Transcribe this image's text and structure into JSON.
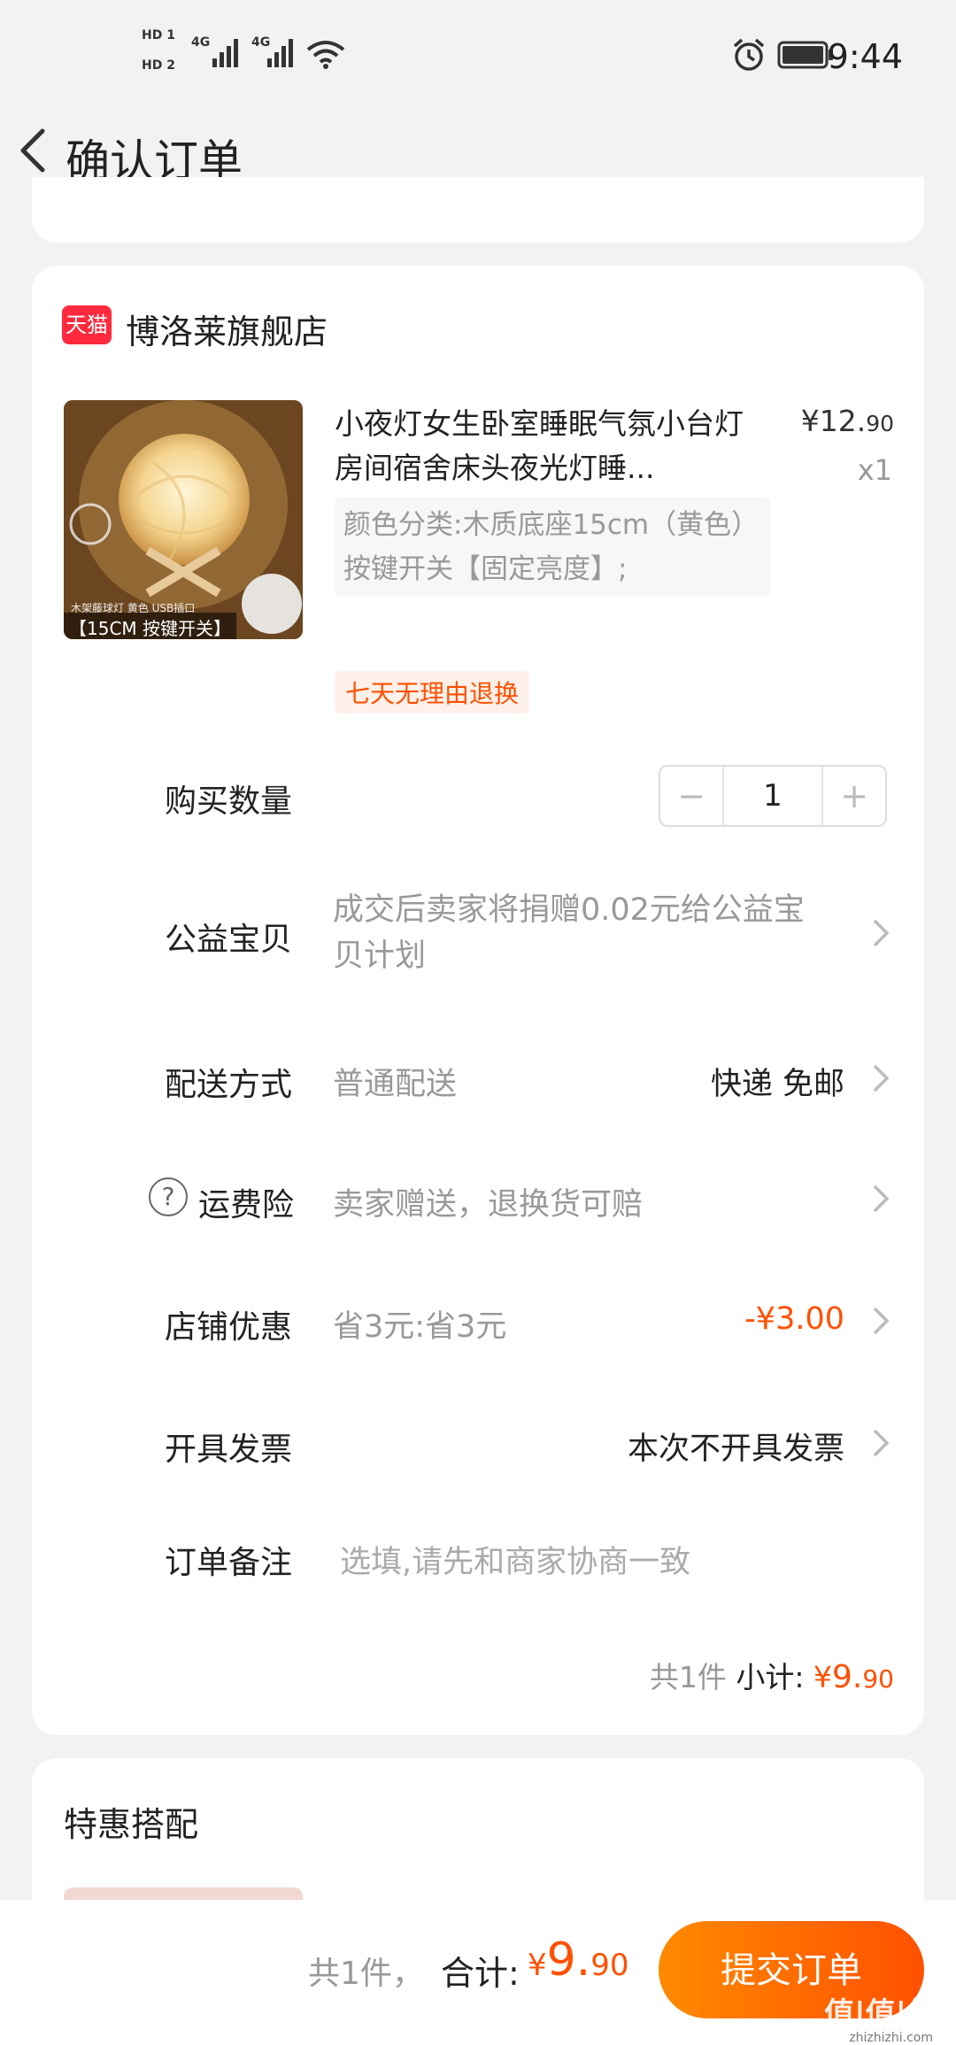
{
  "status_bar": {
    "sim1": "HD 1",
    "sim2": "HD 2",
    "net1": "4G",
    "net2": "4G",
    "time": "9:44"
  },
  "header": {
    "title": "确认订单"
  },
  "shop": {
    "badge": "天猫",
    "name": "博洛莱旗舰店"
  },
  "product": {
    "title": "小夜灯女生卧室睡眠气氛小台灯房间宿舍床头夜光灯睡...",
    "price_currency": "¥",
    "price_int": "12.",
    "price_dec": "90",
    "quantity_label": "x1",
    "sku": "颜色分类:木质底座15cm（黄色）按键开关【固定亮度】;",
    "return_tag": "七天无理由退换",
    "image_caption_small": "木架藤球灯 黄色 USB插口",
    "image_caption": "【15CM 按键开关】"
  },
  "quantity": {
    "label": "购买数量",
    "minus": "−",
    "value": "1",
    "plus": "+"
  },
  "charity": {
    "label": "公益宝贝",
    "value": "成交后卖家将捐赠0.02元给公益宝贝计划"
  },
  "delivery": {
    "label": "配送方式",
    "value": "普通配送",
    "right": "快递 免邮"
  },
  "insurance": {
    "label": "运费险",
    "value": "卖家赠送，退换货可赔"
  },
  "discount": {
    "label": "店铺优惠",
    "value": "省3元:省3元",
    "right": "-¥3.00"
  },
  "invoice": {
    "label": "开具发票",
    "right": "本次不开具发票"
  },
  "note": {
    "label": "订单备注",
    "placeholder": "选填,请先和商家协商一致"
  },
  "subtotal": {
    "count": "共1件",
    "label": "小计:",
    "currency": "¥",
    "int": "9.",
    "dec": "90"
  },
  "bundle": {
    "title": "特惠搭配"
  },
  "bottom": {
    "count": "共1件，",
    "label": "合计:",
    "currency": "¥",
    "int": "9.",
    "dec": "90",
    "submit": "提交订单"
  },
  "watermark": {
    "logo": "值|值|值",
    "site": "zhizhizhi.com"
  },
  "colors": {
    "accent": "#ff5000",
    "tmall_red": "#ff2a3d",
    "bg": "#f2f2f2"
  }
}
